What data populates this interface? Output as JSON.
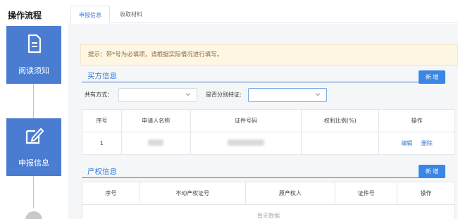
{
  "sidebar": {
    "title": "操作流程",
    "steps": [
      {
        "label": "阅读须知",
        "icon": "document-icon"
      },
      {
        "label": "申报信息",
        "icon": "edit-icon"
      }
    ]
  },
  "tabs": [
    {
      "label": "申报信息",
      "active": true
    },
    {
      "label": "收取材料",
      "active": false
    }
  ],
  "tip": "提示：带*号为必填项，请根据实际情况进行填写。",
  "buyer": {
    "title": "买方信息",
    "new_button": "新 增",
    "share_label": "共有方式：",
    "share_value": "",
    "separate_label": "是否分别持证:",
    "separate_value": "",
    "columns": [
      "序号",
      "申请人名称",
      "证件号码",
      "权利比例(%)",
      "操作"
    ],
    "rows": [
      {
        "index": "1",
        "edit": "编辑",
        "delete": "删除"
      }
    ]
  },
  "property": {
    "title": "产权信息",
    "new_button": "新 增",
    "columns": [
      "序号",
      "不动产权证号",
      "原产权人",
      "证件号",
      "操作"
    ],
    "empty_text": "暂无数据"
  },
  "colors": {
    "accent": "#3a7bd5",
    "sidebar_step": "#4a7dd1",
    "tip_bg": "#fdf6e3"
  }
}
